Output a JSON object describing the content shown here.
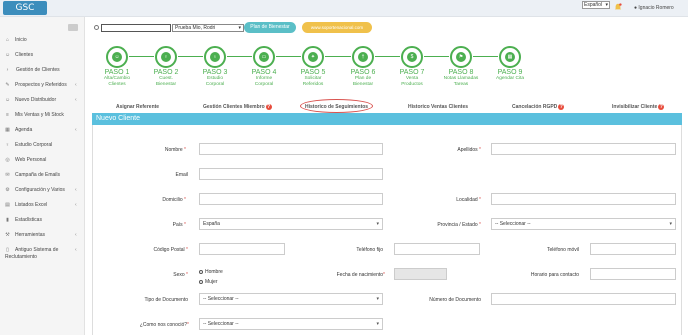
{
  "header": {
    "logo": "GSC",
    "language": "Español",
    "user": "Ignacio Romero"
  },
  "sidebar": {
    "items": [
      {
        "label": "Inicio",
        "icon": "home-icon",
        "chevron": false
      },
      {
        "label": "Clientes",
        "icon": "user-icon",
        "chevron": false
      },
      {
        "label": "Gestión de Clientes",
        "icon": "chevron-right-icon",
        "chevron": false
      },
      {
        "label": "Prospectos y Referidos",
        "icon": "pen-icon",
        "chevron": true
      },
      {
        "label": "Nuevo Distribuidor",
        "icon": "user-icon",
        "chevron": true
      },
      {
        "label": "Mis Ventas y Mi Stock",
        "icon": "list-icon",
        "chevron": false
      },
      {
        "label": "Agenda",
        "icon": "calendar-icon",
        "chevron": true
      },
      {
        "label": "Estudio Corporal",
        "icon": "body-icon",
        "chevron": false
      },
      {
        "label": "Web Personal",
        "icon": "globe-icon",
        "chevron": false
      },
      {
        "label": "Campaña de Emails",
        "icon": "mail-icon",
        "chevron": false
      },
      {
        "label": "Configuración y Varios",
        "icon": "gear-icon",
        "chevron": true
      },
      {
        "label": "Listados Excel",
        "icon": "table-icon",
        "chevron": true
      },
      {
        "label": "Estadísticas",
        "icon": "chart-icon",
        "chevron": false
      },
      {
        "label": "Herramientas",
        "icon": "wrench-icon",
        "chevron": true
      },
      {
        "label": "Antiguo Sistema de",
        "label2": "Reclutamiento",
        "icon": "file-icon",
        "chevron": true
      }
    ]
  },
  "toolbar": {
    "client_select": "Prueba Mio, Rodri",
    "plan_button": "Plan de Bienestar",
    "web_button": "www.soportenacional.com"
  },
  "steps": [
    {
      "num": "PASO 1",
      "l1": "Alta/Cambio",
      "l2": "Clientes",
      "icon": "user-icon"
    },
    {
      "num": "PASO 2",
      "l1": "Cuest.",
      "l2": "Bienestar",
      "icon": "person-icon"
    },
    {
      "num": "PASO 3",
      "l1": "Estudio",
      "l2": "Corporal",
      "icon": "body-icon"
    },
    {
      "num": "PASO 4",
      "l1": "Informe",
      "l2": "Corporal",
      "icon": "monitor-icon"
    },
    {
      "num": "PASO 5",
      "l1": "Solicitar",
      "l2": "Referidos",
      "icon": "group-icon"
    },
    {
      "num": "PASO 6",
      "l1": "Plan de",
      "l2": "Bienestar",
      "icon": "cutlery-icon"
    },
    {
      "num": "PASO 7",
      "l1": "Venta",
      "l2": "Productos",
      "icon": "money-icon"
    },
    {
      "num": "PASO 8",
      "l1": "Notas Llamadas",
      "l2": "Tareas",
      "icon": "tag-icon"
    },
    {
      "num": "PASO 9",
      "l1": "Agendar Cita",
      "l2": "",
      "icon": "calendar-icon"
    }
  ],
  "tabs": [
    {
      "label": "Asignar Referente",
      "help": false
    },
    {
      "label": "Gestión Clientes Miembro",
      "help": true
    },
    {
      "label": "Historico de Seguimientos",
      "help": false
    },
    {
      "label": "Historico Ventas Clientes",
      "help": false
    },
    {
      "label": "Cancelación RGPD",
      "help": true
    },
    {
      "label": "Invisibilizar Cliente",
      "help": true
    }
  ],
  "help_symbol": "?",
  "panel": {
    "title": "Nuevo Cliente"
  },
  "form": {
    "nombre": "Nombre",
    "apellidos": "Apellidos",
    "email": "Email",
    "domicilio": "Domicilio",
    "localidad": "Localidad",
    "pais": "País",
    "pais_value": "España",
    "provincia": "Provincia / Estado",
    "provincia_value": "-- Seleccionar --",
    "codigo_postal": "Código Postal",
    "telefono_fijo": "Teléfono fijo",
    "telefono_movil": "Teléfono móvil",
    "sexo": "Sexo",
    "hombre": "Hombre",
    "mujer": "Mujer",
    "fecha_nacimiento": "Fecha de nacimiento",
    "horario": "Horario para contacto",
    "tipo_documento": "Tipo de Documento",
    "tipo_documento_value": "-- Seleccionar --",
    "numero_documento": "Número de Documento",
    "como_conocio": "¿Como nos conoció?",
    "como_conocio_value": "-- Seleccionar --"
  },
  "colors": {
    "accent": "#5bc0de",
    "step_green": "#4caf50",
    "brand_blue": "#3c8dbc",
    "required": "#d9534f"
  }
}
